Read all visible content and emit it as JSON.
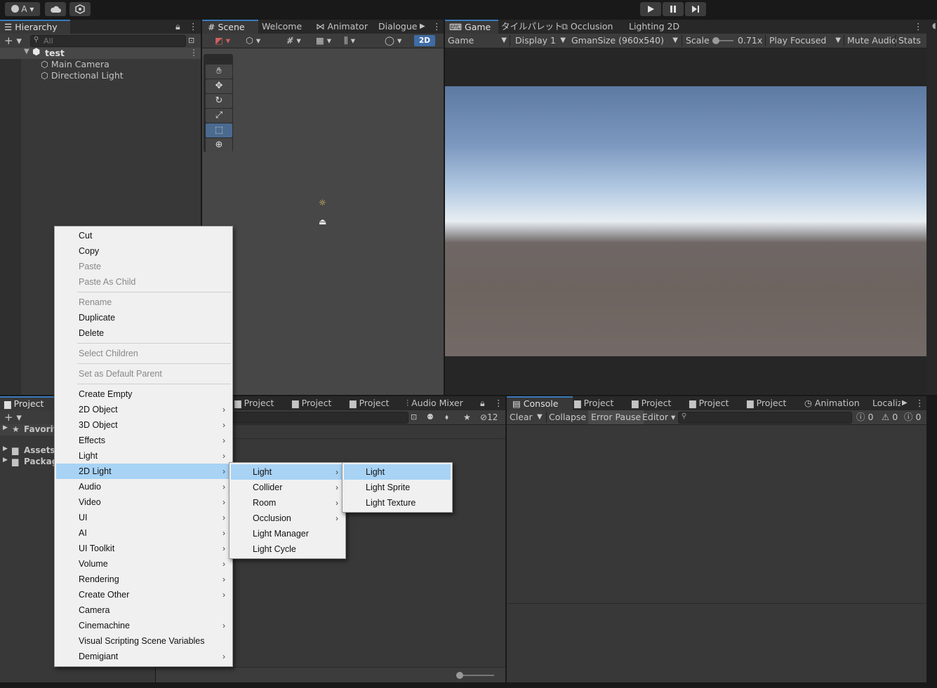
{
  "topbar": {
    "account": "A",
    "cloud_icon": "cloud-icon",
    "collab_icon": "collab-icon",
    "play_icon": "play-icon",
    "pause_icon": "pause-icon",
    "step_icon": "step-icon"
  },
  "hierarchy": {
    "tab": "Hierarchy",
    "search_placeholder": "All",
    "scene_name": "test",
    "items": [
      "Main Camera",
      "Directional Light"
    ]
  },
  "scene_tabs": [
    "Scene",
    "Welcome",
    "Animator",
    "Dialogue"
  ],
  "scene_toolbar": {
    "mode_2d": "2D"
  },
  "game_tabs": [
    "Game",
    "タイルパレット",
    "Occlusion",
    "Lighting 2D"
  ],
  "game_toolbar": {
    "view": "Game",
    "display": "Display 1",
    "resolution": "GmanSize (960x540)",
    "scale_label": "Scale",
    "scale_value": "0.71x",
    "play_mode": "Play Focused",
    "mute": "Mute Audio",
    "stats": "Stats"
  },
  "project_left": {
    "tab": "Project",
    "tree": [
      "Favorites",
      "Assets",
      "Packages"
    ]
  },
  "project_mid_tabs": [
    "Project",
    "Project",
    "Project",
    "Audio Mixer"
  ],
  "project_mid_hidden_count": "12",
  "console_tabs": [
    "Console",
    "Project",
    "Project",
    "Project",
    "Project",
    "Animation",
    "Localiz"
  ],
  "console_toolbar": {
    "clear": "Clear",
    "collapse": "Collapse",
    "error_pause": "Error Pause",
    "editor": "Editor",
    "info_count": "0",
    "warn_count": "0",
    "error_count": "0"
  },
  "context_menu": {
    "group1": [
      {
        "label": "Cut",
        "enabled": true
      },
      {
        "label": "Copy",
        "enabled": true
      },
      {
        "label": "Paste",
        "enabled": false
      },
      {
        "label": "Paste As Child",
        "enabled": false
      }
    ],
    "group2": [
      {
        "label": "Rename",
        "enabled": false
      },
      {
        "label": "Duplicate",
        "enabled": true
      },
      {
        "label": "Delete",
        "enabled": true
      }
    ],
    "group3": [
      {
        "label": "Select Children",
        "enabled": false
      }
    ],
    "group4": [
      {
        "label": "Set as Default Parent",
        "enabled": false
      }
    ],
    "group5": [
      {
        "label": "Create Empty",
        "submenu": false
      },
      {
        "label": "2D Object",
        "submenu": true
      },
      {
        "label": "3D Object",
        "submenu": true
      },
      {
        "label": "Effects",
        "submenu": true
      },
      {
        "label": "Light",
        "submenu": true
      },
      {
        "label": "2D Light",
        "submenu": true,
        "highlighted": true
      },
      {
        "label": "Audio",
        "submenu": true
      },
      {
        "label": "Video",
        "submenu": true
      },
      {
        "label": "UI",
        "submenu": true
      },
      {
        "label": "AI",
        "submenu": true
      },
      {
        "label": "UI Toolkit",
        "submenu": true
      },
      {
        "label": "Volume",
        "submenu": true
      },
      {
        "label": "Rendering",
        "submenu": true
      },
      {
        "label": "Create Other",
        "submenu": true
      },
      {
        "label": "Camera",
        "submenu": false
      },
      {
        "label": "Cinemachine",
        "submenu": true
      },
      {
        "label": "Visual Scripting Scene Variables",
        "submenu": false
      },
      {
        "label": "Demigiant",
        "submenu": true
      }
    ]
  },
  "submenu_2d_light": [
    {
      "label": "Light",
      "submenu": true,
      "highlighted": true
    },
    {
      "label": "Collider",
      "submenu": true
    },
    {
      "label": "Room",
      "submenu": true
    },
    {
      "label": "Occlusion",
      "submenu": true
    },
    {
      "label": "Light Manager",
      "submenu": false
    },
    {
      "label": "Light Cycle",
      "submenu": false
    }
  ],
  "submenu_light": [
    {
      "label": "Light",
      "highlighted": true
    },
    {
      "label": "Light Sprite"
    },
    {
      "label": "Light Texture"
    }
  ]
}
